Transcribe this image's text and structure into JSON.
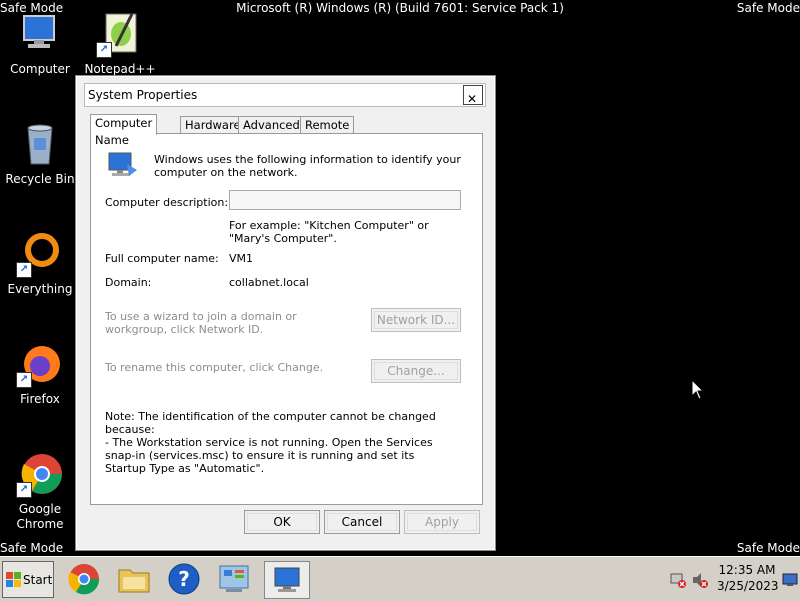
{
  "desktop": {
    "safe_mode_label": "Safe Mode",
    "title": "Microsoft (R) Windows (R) (Build 7601: Service Pack 1)",
    "icons": [
      {
        "label": "Computer",
        "icon": "computer-icon"
      },
      {
        "label": "Notepad++",
        "icon": "notepadpp-icon"
      },
      {
        "label": "Recycle Bin",
        "icon": "recycle-bin-icon"
      },
      {
        "label": "Everything",
        "icon": "everything-icon"
      },
      {
        "label": "Firefox",
        "icon": "firefox-icon"
      },
      {
        "label": "Google Chrome",
        "icon": "chrome-icon"
      }
    ]
  },
  "dialog": {
    "title": "System Properties",
    "close": "✕",
    "tabs": [
      "Computer Name",
      "Hardware",
      "Advanced",
      "Remote"
    ],
    "active_tab": "Computer Name",
    "intro": "Windows uses the following information to identify your computer on the network.",
    "computer_description_label": "Computer description:",
    "computer_description_value": "",
    "example": "For example: \"Kitchen Computer\" or \"Mary's Computer\".",
    "full_name_label": "Full computer name:",
    "full_name_value": "VM1",
    "domain_label": "Domain:",
    "domain_value": "collabnet.local",
    "network_text": "To use a wizard to join a domain or workgroup, click Network ID.",
    "network_button": "Network ID...",
    "rename_text": "To rename this computer, click Change.",
    "change_button": "Change...",
    "note": "Note: The identification of the computer cannot be changed because:\n- The Workstation service is not running. Open the Services snap-in (services.msc) to ensure it is running and set its Startup Type as \"Automatic\".",
    "ok_button": "OK",
    "cancel_button": "Cancel",
    "apply_button": "Apply"
  },
  "taskbar": {
    "start_label": "Start",
    "time": "12:35 AM",
    "date": "3/25/2023"
  },
  "colors": {
    "desktop": "#000000",
    "dialog_bg": "#f0f0f0",
    "taskbar_bg": "#d4d0c8"
  }
}
